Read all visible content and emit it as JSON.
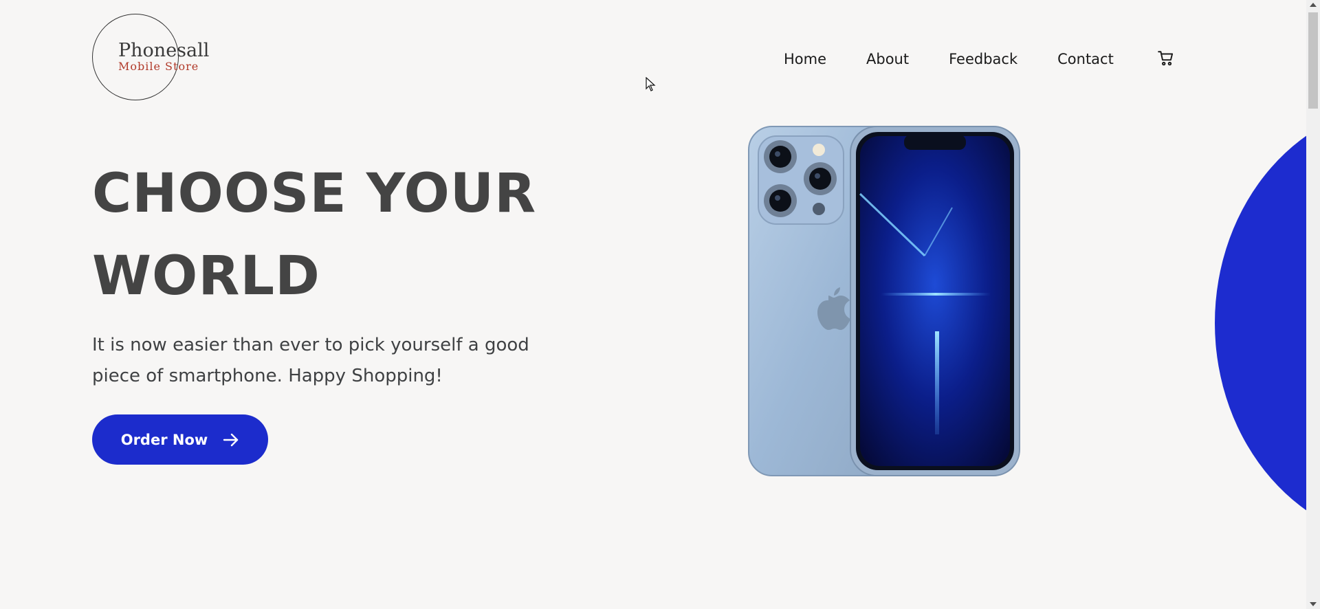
{
  "logo": {
    "title": "Phonesall",
    "subtitle": "Mobile Store"
  },
  "nav": {
    "items": [
      {
        "label": "Home"
      },
      {
        "label": "About"
      },
      {
        "label": "Feedback"
      },
      {
        "label": "Contact"
      }
    ],
    "cart_icon": "cart-icon"
  },
  "hero": {
    "title_line1": "CHOOSE YOUR",
    "title_line2": "WORLD",
    "description": "It is now easier than ever to pick yourself a good piece of smartphone. Happy Shopping!",
    "cta_label": "Order Now",
    "cta_icon": "arrow-right-icon"
  },
  "colors": {
    "accent": "#1c2ccc",
    "background": "#f7f6f5",
    "heading": "#444444",
    "logo_subtitle": "#b13a2a"
  }
}
